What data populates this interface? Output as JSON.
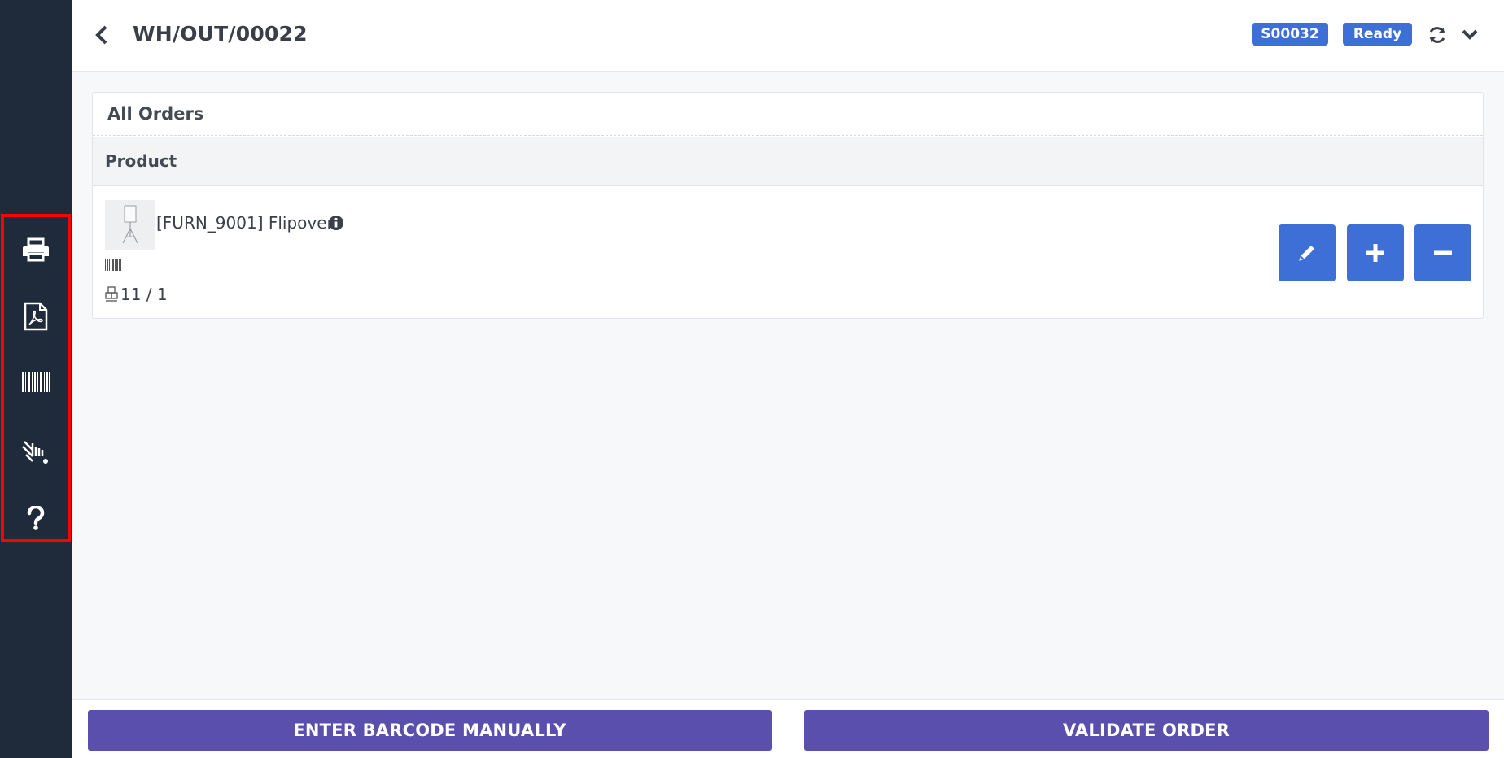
{
  "header": {
    "title": "WH/OUT/00022",
    "order_ref": "S00032",
    "status": "Ready"
  },
  "sidebar": {
    "items": [
      {
        "icon": "printer-icon",
        "label": "Print"
      },
      {
        "icon": "pdf-icon",
        "label": "PDF"
      },
      {
        "icon": "barcode-icon",
        "label": "Barcode"
      },
      {
        "icon": "scanner-icon",
        "label": "Scanner"
      },
      {
        "icon": "question-icon",
        "label": "Help"
      }
    ]
  },
  "card": {
    "title": "All Orders",
    "column_header": "Product",
    "product": {
      "name": "[FURN_9001] Flipover",
      "quantity": "11 / 1"
    }
  },
  "footer": {
    "enter_barcode_label": "ENTER BARCODE MANUALLY",
    "validate_label": "VALIDATE ORDER"
  },
  "colors": {
    "sidebar_bg": "#1f2b3b",
    "accent_blue": "#3d6fd6",
    "footer_button": "#5b4fae",
    "highlight_border": "#ff0000"
  }
}
